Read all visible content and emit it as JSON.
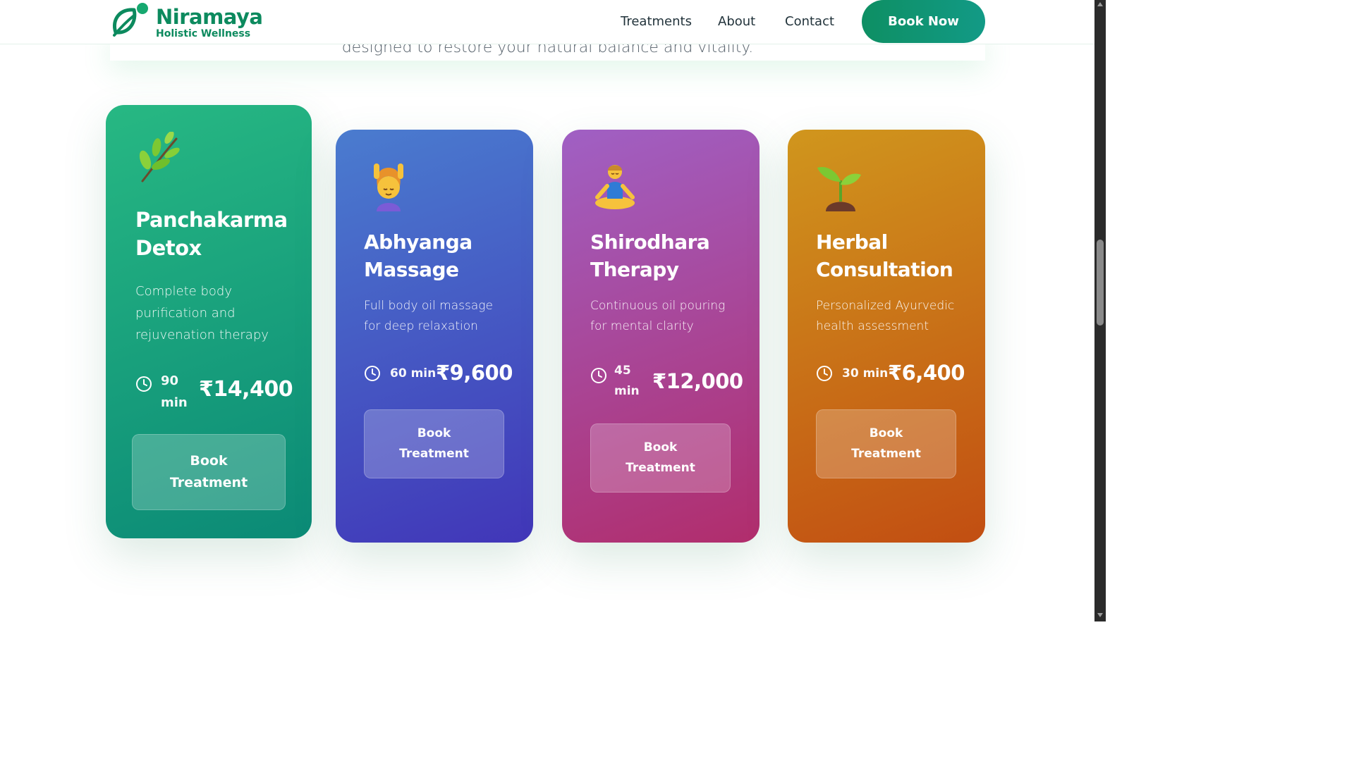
{
  "header": {
    "brand": "Niramaya",
    "tagline": "Holistic Wellness",
    "logo_icon": "leaf-logo",
    "nav": [
      "Treatments",
      "About",
      "Contact"
    ],
    "cta": "Book Now",
    "brand_color": "#0c8a5e"
  },
  "intro": {
    "text": "designed to restore your natural balance and vitality."
  },
  "treatments": [
    {
      "icon": "herb-icon",
      "title": "Panchakarma Detox",
      "description": "Complete body purification and rejuvenation therapy",
      "duration": "90 min",
      "price": "₹14,400",
      "button": "Book Treatment",
      "color": "#1fa67a"
    },
    {
      "icon": "massage-icon",
      "title": "Abhyanga Massage",
      "description": "Full body oil massage for deep relaxation",
      "duration": "60 min",
      "price": "₹9,600",
      "button": "Book Treatment",
      "color": "#4658c2"
    },
    {
      "icon": "meditation-icon",
      "title": "Shirodhara Therapy",
      "description": "Continuous oil pouring for mental clarity",
      "duration": "45 min",
      "price": "₹12,000",
      "button": "Book Treatment",
      "color": "#a8479a"
    },
    {
      "icon": "seedling-icon",
      "title": "Herbal Consultation",
      "description": "Personalized Ayurvedic health assessment",
      "duration": "30 min",
      "price": "₹6,400",
      "button": "Book Treatment",
      "color": "#c7701a"
    }
  ]
}
